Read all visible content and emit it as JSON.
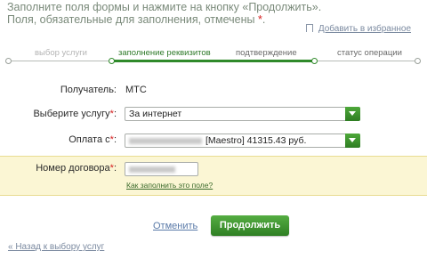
{
  "intro": {
    "line1": "Заполните поля формы и нажмите на кнопку «Продолжить».",
    "line2": "Поля, обязательные для заполнения, отмечены",
    "required_mark": "*",
    "line2_end": "."
  },
  "favorites": {
    "label": "Добавить в избранное",
    "icon": "bookmark-icon"
  },
  "steps": [
    {
      "label": "выбор услуги",
      "state": "done"
    },
    {
      "label": "заполнение реквизитов",
      "state": "active"
    },
    {
      "label": "подтверждение",
      "state": "pending"
    },
    {
      "label": "статус операции",
      "state": "pending"
    }
  ],
  "form": {
    "recipient_label": "Получатель:",
    "recipient_value": "МТС",
    "service_label": "Выберите услугу",
    "service_value": "За интернет",
    "payment_label": "Оплата с",
    "payment_value": "[Maestro] 41315.43 руб.",
    "required_mark": "*",
    "label_suffix": ":",
    "contract_label": "Номер договора",
    "contract_hint": "Как заполнить это поле?"
  },
  "actions": {
    "cancel": "Отменить",
    "continue": "Продолжить",
    "back": "« Назад к выбору услуг"
  },
  "colors": {
    "accent_green": "#2f8a2a",
    "required_red": "#d62020",
    "highlight_band": "#fbf6d4",
    "link_blue": "#5a7aa8"
  }
}
